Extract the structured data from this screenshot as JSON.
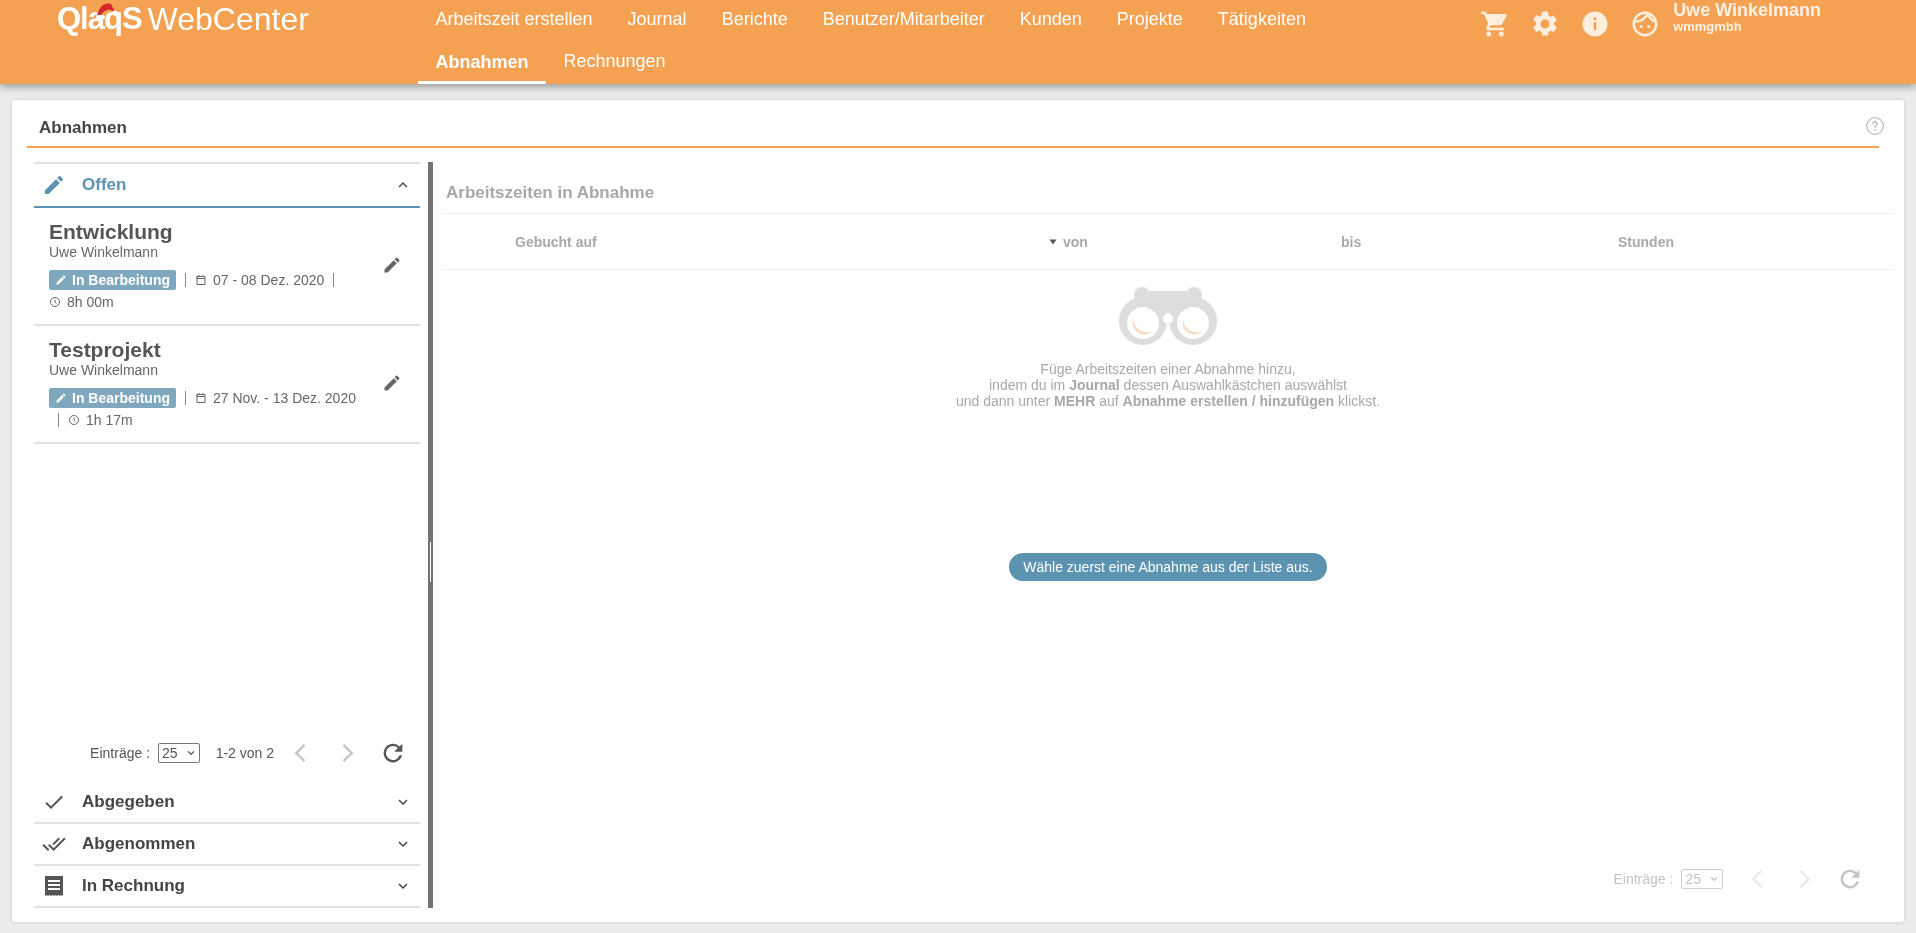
{
  "header": {
    "logo": {
      "brand": "QlaqS",
      "product": "WebCenter"
    },
    "nav": [
      {
        "label": "Arbeitszeit erstellen",
        "selected": false
      },
      {
        "label": "Journal",
        "selected": false
      },
      {
        "label": "Berichte",
        "selected": false
      },
      {
        "label": "Benutzer/Mitarbeiter",
        "selected": false
      },
      {
        "label": "Kunden",
        "selected": false
      },
      {
        "label": "Projekte",
        "selected": false
      },
      {
        "label": "Tätigkeiten",
        "selected": false
      },
      {
        "label": "Abnahmen",
        "selected": true
      },
      {
        "label": "Rechnungen",
        "selected": false
      }
    ],
    "user": {
      "name": "Uwe Winkelmann",
      "company": "wmmgmbh"
    }
  },
  "page": {
    "title": "Abnahmen"
  },
  "sections": [
    {
      "label": "Offen",
      "expanded": true,
      "items": [
        {
          "title": "Entwicklung",
          "person": "Uwe Winkelmann",
          "status": "In Bearbeitung",
          "dates": "07 - 08 Dez. 2020",
          "duration": "8h 00m"
        },
        {
          "title": "Testprojekt",
          "person": "Uwe Winkelmann",
          "status": "In Bearbeitung",
          "dates": "27 Nov. - 13 Dez. 2020",
          "duration": "1h 17m"
        }
      ],
      "pagination": {
        "label": "Einträge :",
        "page_size": "25",
        "range": "1-2 von 2",
        "prev_disabled": true,
        "next_disabled": true
      }
    },
    {
      "label": "Abgegeben",
      "expanded": false
    },
    {
      "label": "Abgenommen",
      "expanded": false
    },
    {
      "label": "In Rechnung",
      "expanded": false
    }
  ],
  "detail": {
    "title": "Arbeitszeiten in Abnahme",
    "disabled": true,
    "columns": [
      {
        "label": "Gebucht auf",
        "sorted": false
      },
      {
        "label": "von",
        "sorted": true
      },
      {
        "label": "bis",
        "sorted": false
      },
      {
        "label": "Stunden",
        "sorted": false
      }
    ],
    "empty_text": "Füge Arbeitszeiten einer Abnahme hinzu,\nindem du im **Journal** dessen Auswahlkästchen auswählst\nund dann unter **MEHR** auf **Abnahme erstellen / hinzufügen** klickst.",
    "hint": "Wähle zuerst eine Abnahme aus der Liste aus.",
    "pagination": {
      "label": "Einträge :",
      "page_size": "25",
      "prev_disabled": true,
      "next_disabled": true
    }
  }
}
